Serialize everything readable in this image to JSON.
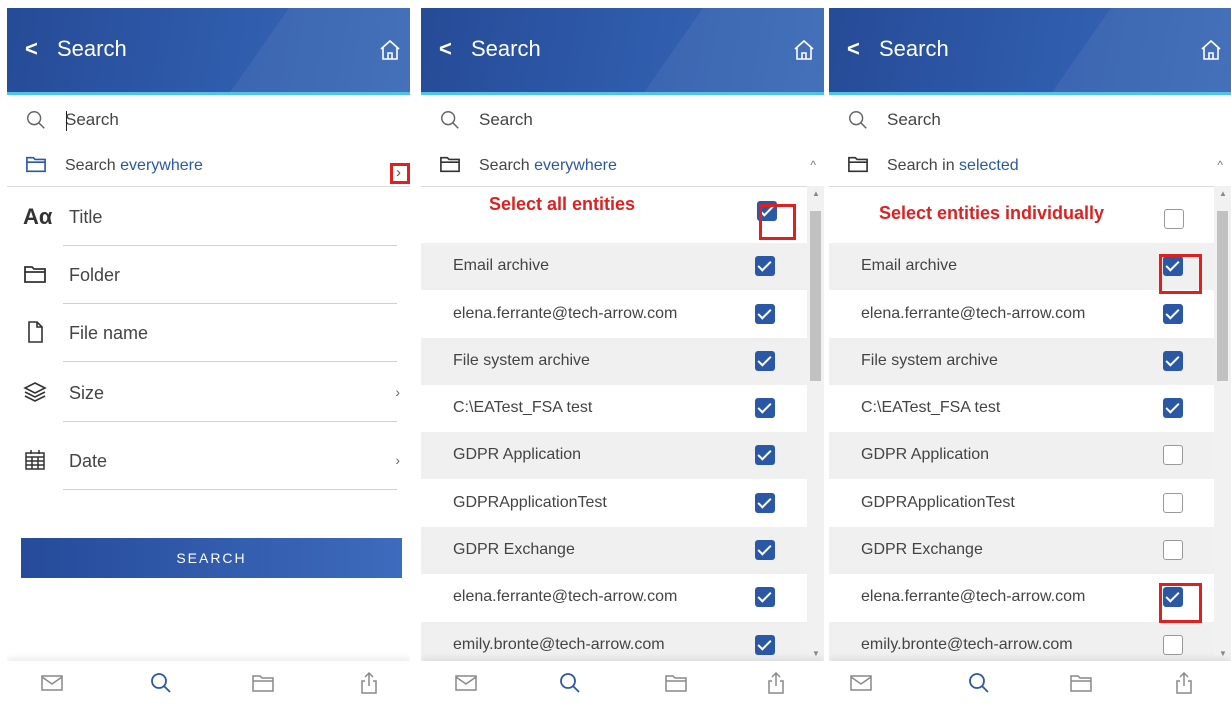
{
  "panels": [
    {
      "header": {
        "back": "<",
        "title": "Search"
      },
      "search": {
        "placeholder": "Search"
      },
      "scope": {
        "prefix": "Search ",
        "highlight": "everywhere"
      },
      "fields": [
        {
          "label": "Title",
          "icon": "text-format-icon",
          "glyph": "Aα"
        },
        {
          "label": "Folder",
          "icon": "folder-icon"
        },
        {
          "label": "File name",
          "icon": "file-icon"
        },
        {
          "label": "Size",
          "icon": "layers-icon"
        },
        {
          "label": "Date",
          "icon": "calendar-icon"
        }
      ],
      "search_button": "SEARCH",
      "expand_arrow": "›"
    },
    {
      "header": {
        "back": "<",
        "title": "Search"
      },
      "search": {
        "placeholder": "Search"
      },
      "scope": {
        "prefix": "Search ",
        "highlight": "everywhere",
        "expand": "^"
      },
      "select_all_label": "Select all entities",
      "select_all_checked": true,
      "items": [
        {
          "label": "Email archive",
          "checked": true
        },
        {
          "label": "elena.ferrante@tech-arrow.com",
          "checked": true
        },
        {
          "label": "File system archive",
          "checked": true
        },
        {
          "label": "C:\\EATest_FSA test",
          "checked": true
        },
        {
          "label": "GDPR Application",
          "checked": true
        },
        {
          "label": "GDPRApplicationTest",
          "checked": true
        },
        {
          "label": "GDPR Exchange",
          "checked": true
        },
        {
          "label": "elena.ferrante@tech-arrow.com",
          "checked": true
        },
        {
          "label": "emily.bronte@tech-arrow.com",
          "checked": true
        }
      ]
    },
    {
      "header": {
        "back": "<",
        "title": "Search"
      },
      "search": {
        "placeholder": "Search"
      },
      "scope": {
        "prefix": "Search in ",
        "highlight": "selected",
        "expand": "^"
      },
      "select_all_label": "Select entities individually",
      "select_all_checked": false,
      "items": [
        {
          "label": "Email archive",
          "checked": true
        },
        {
          "label": "elena.ferrante@tech-arrow.com",
          "checked": true
        },
        {
          "label": "File system archive",
          "checked": true
        },
        {
          "label": "C:\\EATest_FSA test",
          "checked": true
        },
        {
          "label": "GDPR Application",
          "checked": false
        },
        {
          "label": "GDPRApplicationTest",
          "checked": false
        },
        {
          "label": "GDPR Exchange",
          "checked": false
        },
        {
          "label": "elena.ferrante@tech-arrow.com",
          "checked": true
        },
        {
          "label": "emily.bronte@tech-arrow.com",
          "checked": false
        }
      ]
    }
  ],
  "bottom_nav": [
    {
      "icon": "mail-icon"
    },
    {
      "icon": "search-icon",
      "active": true
    },
    {
      "icon": "folder-icon"
    },
    {
      "icon": "share-icon"
    }
  ],
  "colors": {
    "header": "#2c57a8",
    "accent": "#4fc3e8",
    "highlight": "#e02020",
    "checkbox": "#2b57a7"
  }
}
